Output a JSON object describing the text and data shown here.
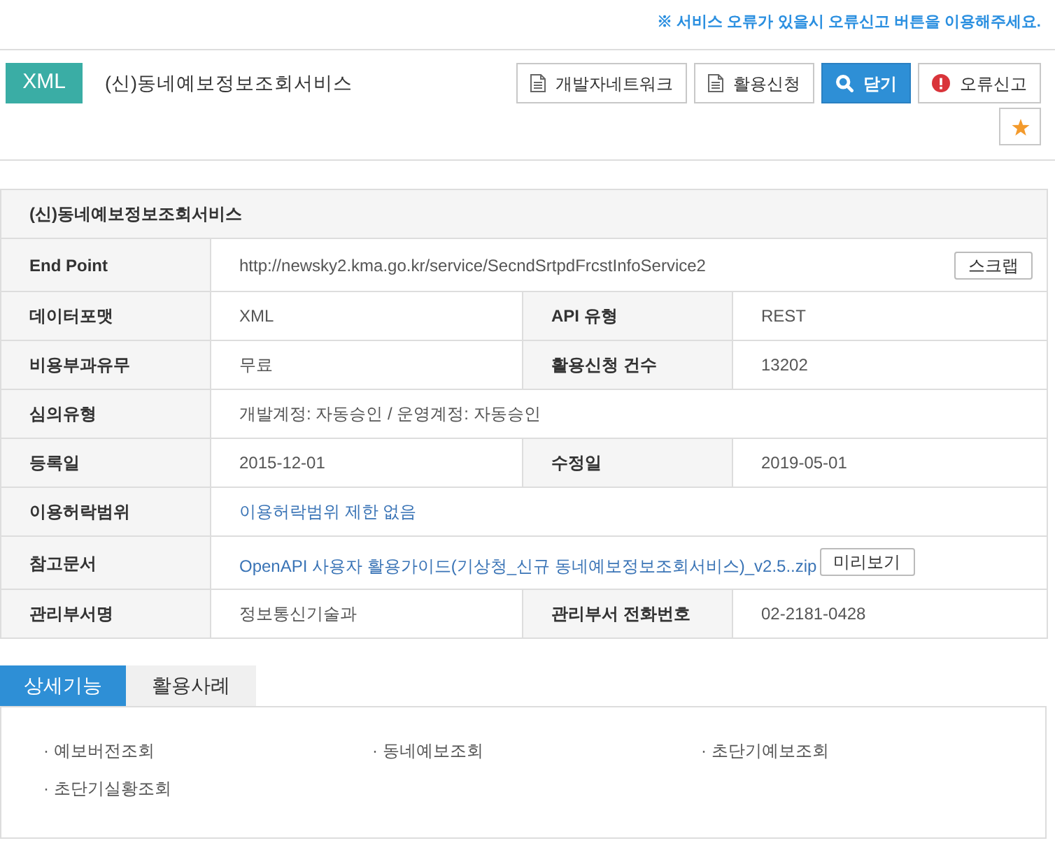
{
  "notice": "※ 서비스 오류가 있을시 오류신고 버튼을 이용해주세요.",
  "header": {
    "badge": "XML",
    "title": "(신)동네예보정보조회서비스",
    "buttons": [
      {
        "label": "개발자네트워크",
        "kind": "document",
        "primary": false
      },
      {
        "label": "활용신청",
        "kind": "document",
        "primary": false
      },
      {
        "label": "닫기",
        "kind": "search",
        "primary": true
      },
      {
        "label": "오류신고",
        "kind": "alert",
        "primary": false
      }
    ]
  },
  "info_table": {
    "title": "(신)동네예보정보조회서비스",
    "rows": [
      [
        {
          "label": "End Point",
          "value": "http://newsky2.kma.go.kr/service/SecndSrtpdFrcstInfoService2",
          "kind": "text",
          "button": "스크랩"
        }
      ],
      [
        {
          "label": "데이터포맷",
          "value": "XML",
          "kind": "text"
        },
        {
          "label": "API 유형",
          "value": "REST",
          "kind": "text"
        }
      ],
      [
        {
          "label": "비용부과유무",
          "value": "무료",
          "kind": "text"
        },
        {
          "label": "활용신청 건수",
          "value": "13202",
          "kind": "text"
        }
      ],
      [
        {
          "label": "심의유형",
          "value": "개발계정: 자동승인 / 운영계정: 자동승인",
          "kind": "text"
        }
      ],
      [
        {
          "label": "등록일",
          "value": "2015-12-01",
          "kind": "text"
        },
        {
          "label": "수정일",
          "value": "2019-05-01",
          "kind": "text"
        }
      ],
      [
        {
          "label": "이용허락범위",
          "value": "이용허락범위 제한 없음",
          "kind": "link"
        }
      ],
      [
        {
          "label": "참고문서",
          "value": "OpenAPI 사용자 활용가이드(기상청_신규 동네예보정보조회서비스)_v2.5..zip",
          "kind": "link",
          "button": "미리보기"
        }
      ],
      [
        {
          "label": "관리부서명",
          "value": "정보통신기술과",
          "kind": "text"
        },
        {
          "label": "관리부서 전화번호",
          "value": "02-2181-0428",
          "kind": "text"
        }
      ]
    ]
  },
  "tabs": [
    {
      "label": "상세기능",
      "selected": true
    },
    {
      "label": "활용사례",
      "selected": false
    }
  ],
  "features": [
    "· 예보버전조회",
    "· 동네예보조회",
    "· 초단기예보조회",
    "· 초단기실황조회"
  ]
}
